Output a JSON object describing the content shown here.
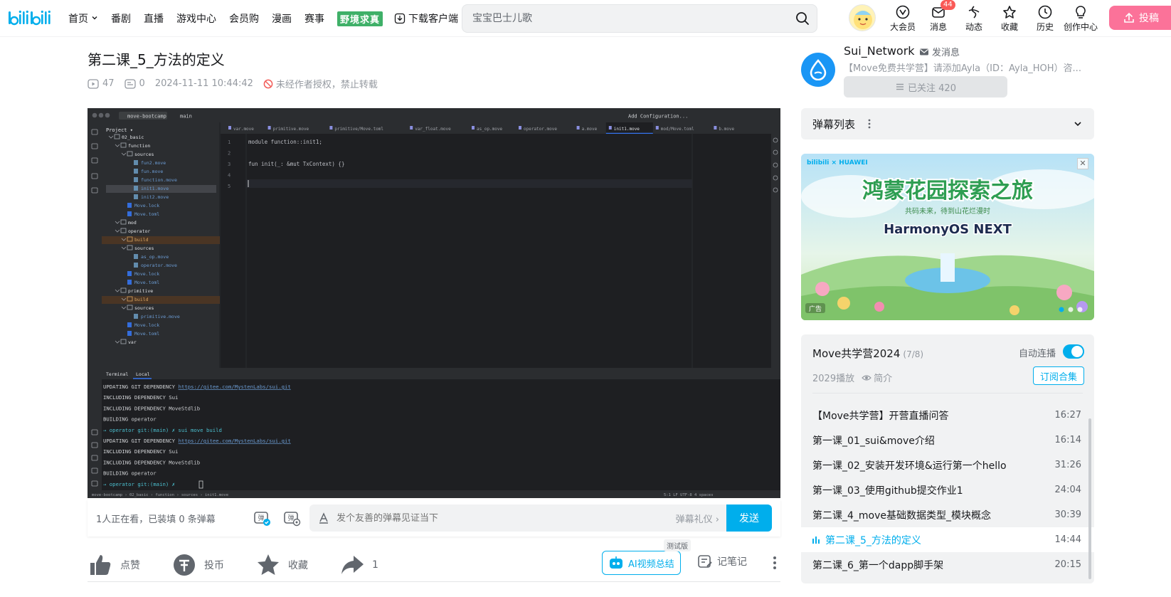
{
  "header": {
    "nav": [
      {
        "label": "首页",
        "has_chevron": true
      },
      {
        "label": "番剧"
      },
      {
        "label": "直播"
      },
      {
        "label": "游戏中心"
      },
      {
        "label": "会员购"
      },
      {
        "label": "漫画"
      },
      {
        "label": "赛事"
      }
    ],
    "promo_label": "野境求真",
    "download_label": "下载客户端",
    "search_placeholder": "宝宝巴士儿歌",
    "icons": [
      {
        "label": "大会员",
        "icon": "vip-icon"
      },
      {
        "label": "消息",
        "icon": "message-icon",
        "badge": "44"
      },
      {
        "label": "动态",
        "icon": "dynamic-icon"
      },
      {
        "label": "收藏",
        "icon": "star-icon"
      },
      {
        "label": "历史",
        "icon": "history-icon"
      },
      {
        "label": "创作中心",
        "icon": "bulb-icon"
      }
    ],
    "upload_label": "投稿"
  },
  "video": {
    "title": "第二课_5_方法的定义",
    "views": "47",
    "danmaku": "0",
    "date": "2024-11-11 10:44:42",
    "copyright": "未经作者授权，禁止转载"
  },
  "danmaku_bar": {
    "viewers": "1人正在看，已装填 0 条弹幕",
    "placeholder": "发个友善的弹幕见证当下",
    "etiquette": "弹幕礼仪 ›",
    "send": "发送"
  },
  "actions": {
    "like": "点赞",
    "coin": "投币",
    "fav": "收藏",
    "share": "1",
    "ai_summary": "AI视频总结",
    "beta_tag": "测试版",
    "notes": "记笔记"
  },
  "uploader": {
    "name": "Sui_Network",
    "message": "发消息",
    "desc": "【Move免费共学营】请添加Ayla（ID：Ayla_HOH）咨...",
    "follow": "已关注 420"
  },
  "danmaku_list": {
    "title": "弹幕列表"
  },
  "ad": {
    "brand_text": "bilibili × HUAWEI",
    "headline": "鸿蒙花园探索之旅",
    "sub": "共码未来，待到山花烂漫时",
    "product": "HarmonyOS NEXT",
    "tag": "广告"
  },
  "playlist": {
    "title": "Move共学营2024",
    "progress": "(7/8)",
    "autoplay_label": "自动连播",
    "autoplay": true,
    "plays": "2029播放",
    "intro": "简介",
    "subscribe": "订阅合集",
    "items": [
      {
        "title": "【Move共学营】开营直播问答",
        "dur": "16:27"
      },
      {
        "title": "第一课_01_sui&move介绍",
        "dur": "16:14"
      },
      {
        "title": "第一课_02_安装开发环境&运行第一个hello",
        "dur": "31:26"
      },
      {
        "title": "第一课_03_使用github提交作业1",
        "dur": "24:04"
      },
      {
        "title": "第二课_4_move基础数据类型_模块概念",
        "dur": "30:39"
      },
      {
        "title": "第二课_5_方法的定义",
        "dur": "14:44",
        "active": true
      },
      {
        "title": "第二课_6_第一个dapp脚手架",
        "dur": "20:15"
      }
    ]
  },
  "ide": {
    "project": "move-bootcamp",
    "branch": "main",
    "config": "Add Configuration...",
    "tabs": [
      "var.move",
      "primitive.move",
      "primitive/Move.toml",
      "var_float.move",
      "as_op.move",
      "operator.move",
      "a.move",
      "init1.move",
      "mod/Move.toml",
      "b.move"
    ],
    "active_tab": "init1.move",
    "tree": [
      {
        "d": 1,
        "t": "02_basic",
        "k": "dir"
      },
      {
        "d": 2,
        "t": "function",
        "k": "dir"
      },
      {
        "d": 3,
        "t": "sources",
        "k": "dir"
      },
      {
        "d": 4,
        "t": "fun2.move",
        "k": "file"
      },
      {
        "d": 4,
        "t": "fun.move",
        "k": "file"
      },
      {
        "d": 4,
        "t": "function.move",
        "k": "file"
      },
      {
        "d": 4,
        "t": "init1.move",
        "k": "file",
        "sel": true
      },
      {
        "d": 4,
        "t": "init2.move",
        "k": "file"
      },
      {
        "d": 3,
        "t": "Move.lock",
        "k": "cfg"
      },
      {
        "d": 3,
        "t": "Move.toml",
        "k": "cfg"
      },
      {
        "d": 2,
        "t": "mod",
        "k": "dir"
      },
      {
        "d": 2,
        "t": "operator",
        "k": "dir"
      },
      {
        "d": 3,
        "t": "build",
        "k": "build"
      },
      {
        "d": 3,
        "t": "sources",
        "k": "dir"
      },
      {
        "d": 4,
        "t": "as_op.move",
        "k": "file"
      },
      {
        "d": 4,
        "t": "operator.move",
        "k": "file"
      },
      {
        "d": 3,
        "t": "Move.lock",
        "k": "cfg"
      },
      {
        "d": 3,
        "t": "Move.toml",
        "k": "cfg"
      },
      {
        "d": 2,
        "t": "primitive",
        "k": "dir"
      },
      {
        "d": 3,
        "t": "build",
        "k": "build"
      },
      {
        "d": 3,
        "t": "sources",
        "k": "dir"
      },
      {
        "d": 4,
        "t": "primitive.move",
        "k": "file"
      },
      {
        "d": 3,
        "t": "Move.lock",
        "k": "cfg"
      },
      {
        "d": 3,
        "t": "Move.toml",
        "k": "cfg"
      },
      {
        "d": 2,
        "t": "var",
        "k": "dir"
      }
    ],
    "code": [
      {
        "n": "1",
        "t": "module function::init1;"
      },
      {
        "n": "2",
        "t": ""
      },
      {
        "n": "3",
        "t": "fun init(_: &mut TxContext) {}"
      },
      {
        "n": "4",
        "t": ""
      },
      {
        "n": "5",
        "t": ""
      }
    ],
    "terminal_tabs": [
      "Terminal",
      "Local"
    ],
    "terminal": [
      {
        "p": "UPDATING GIT DEPENDENCY ",
        "l": "https://gitee.com/MystenLabs/sui.git"
      },
      {
        "p": "INCLUDING DEPENDENCY Sui"
      },
      {
        "p": "INCLUDING DEPENDENCY MoveStdlib"
      },
      {
        "p": "BUILDING operator"
      },
      {
        "p": "→  operator git:(main) ✗ sui move build",
        "prompt": true
      },
      {
        "p": "UPDATING GIT DEPENDENCY ",
        "l": "https://gitee.com/MystenLabs/sui.git"
      },
      {
        "p": "INCLUDING DEPENDENCY Sui"
      },
      {
        "p": "INCLUDING DEPENDENCY MoveStdlib"
      },
      {
        "p": "BUILDING operator"
      },
      {
        "p": "→  operator git:(main) ✗ ",
        "prompt": true
      }
    ],
    "status": "move-bootcamp › 02_basic › function › sources › init1.move",
    "status_right": "5:1   LF   UTF-8   4 spaces"
  },
  "colors": {
    "accent": "#00aeec",
    "pink": "#fb7299"
  }
}
